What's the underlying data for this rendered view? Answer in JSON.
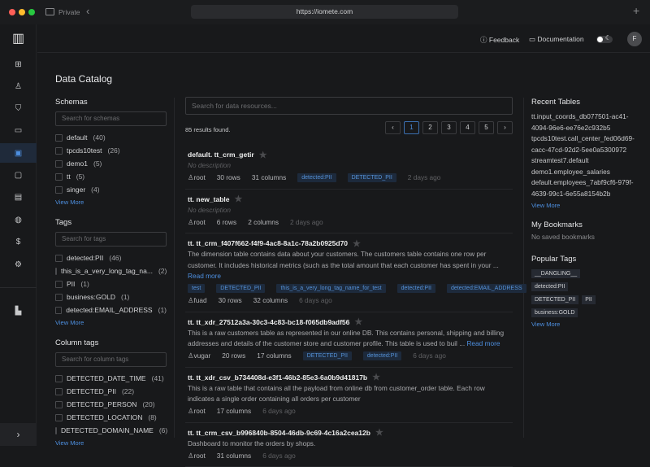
{
  "browser": {
    "mode": "Private",
    "url": "https://iomete.com"
  },
  "header": {
    "feedback": "Feedback",
    "documentation": "Documentation",
    "avatar": "F"
  },
  "page": {
    "title": "Data Catalog"
  },
  "filters": {
    "schemas": {
      "title": "Schemas",
      "placeholder": "Search for schemas",
      "items": [
        {
          "label": "default",
          "count": "(40)"
        },
        {
          "label": "tpcds10test",
          "count": "(26)"
        },
        {
          "label": "demo1",
          "count": "(5)"
        },
        {
          "label": "tt",
          "count": "(5)"
        },
        {
          "label": "singer",
          "count": "(4)"
        }
      ],
      "view_more": "View More"
    },
    "tags": {
      "title": "Tags",
      "placeholder": "Search for tags",
      "items": [
        {
          "label": "detected:PII",
          "count": "(46)"
        },
        {
          "label": "this_is_a_very_long_tag_na...",
          "count": "(2)"
        },
        {
          "label": "PII",
          "count": "(1)"
        },
        {
          "label": "business:GOLD",
          "count": "(1)"
        },
        {
          "label": "detected:EMAIL_ADDRESS",
          "count": "(1)"
        }
      ],
      "view_more": "View More"
    },
    "column_tags": {
      "title": "Column tags",
      "placeholder": "Search for column tags",
      "items": [
        {
          "label": "DETECTED_DATE_TIME",
          "count": "(41)"
        },
        {
          "label": "DETECTED_PII",
          "count": "(22)"
        },
        {
          "label": "DETECTED_PERSON",
          "count": "(20)"
        },
        {
          "label": "DETECTED_LOCATION",
          "count": "(8)"
        },
        {
          "label": "DETECTED_DOMAIN_NAME",
          "count": "(6)"
        }
      ],
      "view_more": "View More"
    }
  },
  "main": {
    "search_placeholder": "Search for data resources...",
    "results_count": "85 results found.",
    "pager": {
      "prev": "‹",
      "pages": [
        "1",
        "2",
        "3",
        "4",
        "5"
      ],
      "next": "›",
      "current": "1"
    },
    "results": [
      {
        "title": "default. tt_crm_getir",
        "description": "No description",
        "owner": "root",
        "rows": "30 rows",
        "columns": "31 columns",
        "tags": [
          "detected:PII",
          "DETECTED_PII"
        ],
        "ago": "2 days ago"
      },
      {
        "title": "tt. new_table",
        "description": "No description",
        "owner": "root",
        "rows": "6 rows",
        "columns": "2 columns",
        "tags": [],
        "ago": "2 days ago"
      },
      {
        "title": "tt. tt_crm_f407f662-f4f9-4ac8-8a1c-78a2b0925d70",
        "description": "The dimension table contains data about your customers. The customers table contains one row per customer. It includes historical metrics (such as the total amount that each customer has spent in your ...",
        "read_more": "Read more",
        "owner": "fuad",
        "rows": "30 rows",
        "columns": "32 columns",
        "tags": [
          "test",
          "DETECTED_PII",
          "this_is_a_very_long_tag_name_for_test",
          "detected:PII",
          "detected:EMAIL_ADDRESS"
        ],
        "ago": "6 days ago"
      },
      {
        "title": "tt. tt_xdr_27512a3a-30c3-4c83-bc18-f065db9adf56",
        "description": "This is a raw customers table as represented in our online DB. This contains personal, shipping and billing addresses and details of the customer store and customer profile. This table is used to buil ...",
        "read_more": "Read more",
        "owner": "vugar",
        "rows": "20 rows",
        "columns": "17 columns",
        "tags": [
          "DETECTED_PII",
          "detected:PII"
        ],
        "ago": "6 days ago"
      },
      {
        "title": "tt. tt_xdr_csv_b734408d-e3f1-46b2-85e3-6a0b9d41817b",
        "description": "This is a raw table that contains all the payload from online db from customer_order table. Each row indicates a single order containing all orders per customer",
        "owner": "root",
        "columns": "17 columns",
        "tags": [],
        "ago": "6 days ago"
      },
      {
        "title": "tt. tt_crm_csv_b996840b-8504-46db-9c69-4c16a2cea12b",
        "description": "Dashboard to monitor the orders by shops.",
        "owner": "root",
        "columns": "31 columns",
        "tags": [],
        "ago": "6 days ago"
      }
    ]
  },
  "right": {
    "recent": {
      "title": "Recent Tables",
      "items": [
        "tt.input_coords_db077501-ac41-4094-96e6-ee76e2c932b5",
        "tpcds10test.call_center_fed06d69-cacc-47cd-92d2-5ee0a5300972",
        "streamtest7.default",
        "demo1.employee_salaries",
        "default.employees_7abf9cf6-979f-4639-99c1-6e55a8154b2b"
      ],
      "view_more": "View More"
    },
    "bookmarks": {
      "title": "My Bookmarks",
      "empty": "No saved bookmarks"
    },
    "popular": {
      "title": "Popular Tags",
      "items": [
        "__DANGLING__",
        "detected:PII",
        "DETECTED_PII",
        "PII",
        "business:GOLD"
      ],
      "view_more": "View More"
    }
  }
}
